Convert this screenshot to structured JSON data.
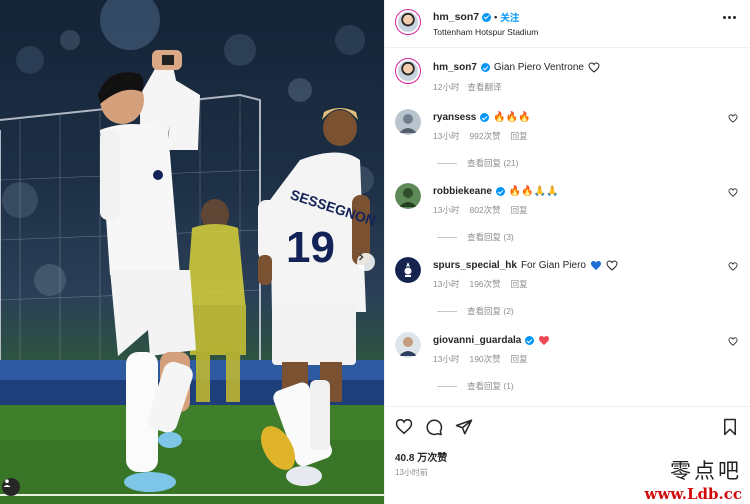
{
  "header": {
    "username": "hm_son7",
    "separator": "•",
    "follow_label": "关注",
    "location": "Tottenham Hotspur Stadium",
    "more_icon": "more-horizontal-icon"
  },
  "caption": {
    "username": "hm_son7",
    "text": "Gian Piero Ventrone",
    "time": "12小时",
    "translate_label": "查看翻译"
  },
  "comments": [
    {
      "username": "ryansess",
      "text": "🔥🔥🔥",
      "time": "13小时",
      "likes": "992次赞",
      "reply_label": "回复",
      "view_replies": "查看回复 (21)",
      "avatar_color": "#6f7f8f"
    },
    {
      "username": "robbiekeane",
      "text": "🔥🔥🙏🙏",
      "time": "13小时",
      "likes": "802次赞",
      "reply_label": "回复",
      "view_replies": "查看回复 (3)",
      "avatar_color": "#3d6b3a"
    },
    {
      "username": "spurs_special_hk",
      "text": "For Gian Piero",
      "time": "13小时",
      "likes": "196次赞",
      "reply_label": "回复",
      "view_replies": "查看回复 (2)",
      "avatar_color": "#15244f"
    },
    {
      "username": "giovanni_guardala",
      "text": "",
      "time": "13小时",
      "likes": "190次赞",
      "reply_label": "回复",
      "view_replies": "查看回复 (1)",
      "avatar_color": "#2c3f5f"
    }
  ],
  "footer": {
    "likes_count": "40.8 万次赞",
    "timestamp": "13小时前"
  },
  "photo": {
    "jersey_name": "SESSEGNON",
    "jersey_number": "19"
  },
  "watermark": {
    "chinese": "零点吧",
    "url": "www.Ldb.cc"
  },
  "colors": {
    "accent": "#0095f6",
    "heart_red": "#ed4956",
    "heart_blue": "#1d6fd6",
    "text": "#262626",
    "muted": "#8e8e8e"
  }
}
